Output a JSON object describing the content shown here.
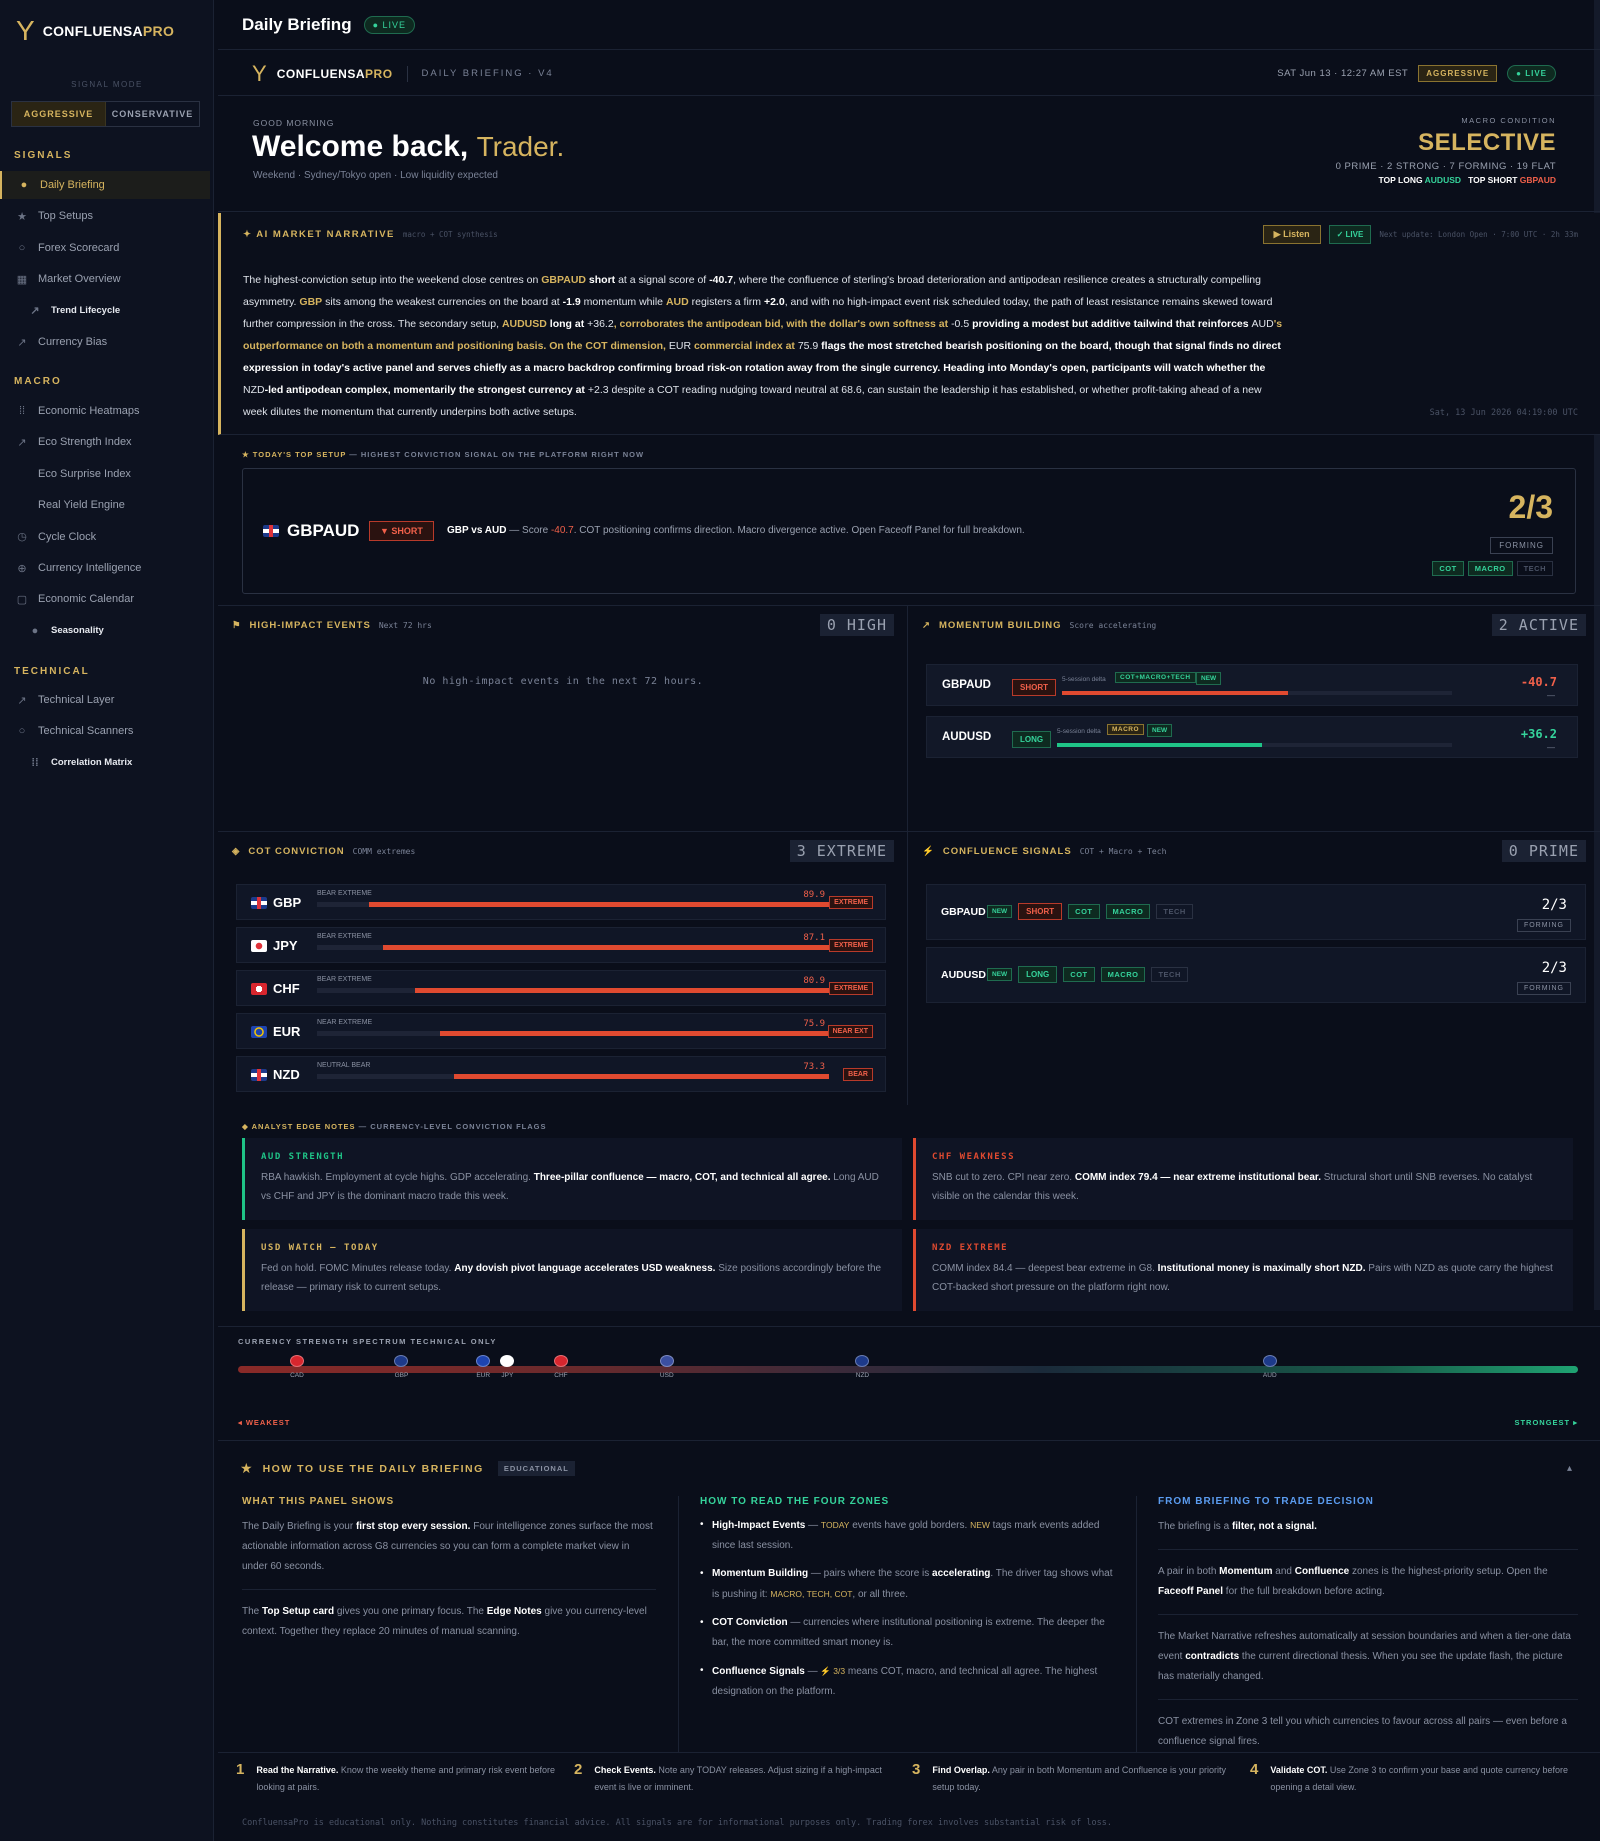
{
  "sidebar": {
    "brand": "CONFLUENSA",
    "brand_pro": "PRO",
    "signal_mode_label": "SIGNAL MODE",
    "mode_aggressive": "AGGRESSIVE",
    "mode_conservative": "CONSERVATIVE",
    "signals_title": "SIGNALS",
    "signals": [
      {
        "label": "Daily Briefing",
        "icon": "person-icon"
      },
      {
        "label": "Top Setups",
        "icon": "star-icon"
      },
      {
        "label": "Forex Scorecard",
        "icon": "circle-icon"
      },
      {
        "label": "Market Overview",
        "icon": "grid-icon"
      },
      {
        "label": "Trend Lifecycle",
        "icon": "trend-icon"
      },
      {
        "label": "Currency Bias",
        "icon": "trend-icon"
      }
    ],
    "macro_title": "MACRO",
    "macro": [
      {
        "label": "Economic Heatmaps",
        "icon": "dots-grid-icon"
      },
      {
        "label": "Eco Strength Index",
        "icon": "trend-icon"
      },
      {
        "label": "Eco Surprise Index",
        "icon": ""
      },
      {
        "label": "Real Yield Engine",
        "icon": ""
      },
      {
        "label": "Cycle Clock",
        "icon": "clock-icon"
      },
      {
        "label": "Currency Intelligence",
        "icon": "plus-circle-icon"
      },
      {
        "label": "Economic Calendar",
        "icon": "square-icon"
      },
      {
        "label": "Seasonality",
        "icon": "dot-icon"
      }
    ],
    "technical_title": "TECHNICAL",
    "technical": [
      {
        "label": "Technical Layer",
        "icon": "trend-icon"
      },
      {
        "label": "Technical Scanners",
        "icon": "circle-icon"
      },
      {
        "label": "Correlation Matrix",
        "icon": "dots-grid-icon"
      }
    ]
  },
  "topbar": {
    "title": "Daily Briefing",
    "live": "● LIVE"
  },
  "header": {
    "brand": "CONFLUENSA",
    "brand_pro": "PRO",
    "version": "DAILY BRIEFING · V4",
    "datetime": "SAT Jun 13 · 12:27 AM EST",
    "mode": "AGGRESSIVE",
    "live": "● LIVE"
  },
  "welcome": {
    "greeting": "GOOD MORNING",
    "title": "Welcome back,",
    "name": "Trader.",
    "subtitle": "Weekend · Sydney/Tokyo open · Low liquidity expected",
    "macro_label": "MACRO CONDITION",
    "macro_value": "SELECTIVE",
    "counts": "0 PRIME · 2 STRONG · 7 FORMING · 19 FLAT",
    "top_long_label": "TOP LONG",
    "top_long": "AUDUSD",
    "top_short_label": "TOP SHORT",
    "top_short": "GBPAUD"
  },
  "narrative": {
    "title": "✦ AI  MARKET NARRATIVE",
    "meta": "macro + COT synthesis",
    "listen": "▶ Listen",
    "live": "✓ LIVE",
    "next_update": "Next update: London Open · 7:00 UTC · 2h 33m",
    "text_parts": [
      "The highest-conviction setup into the weekend close centres on ",
      "GBPAUD",
      " short",
      " at a signal score of ",
      "-40.7",
      ", where the confluence of sterling's broad deterioration and antipodean resilience creates a structurally compelling asymmetry. ",
      "GBP",
      " sits among the weakest currencies on the board at ",
      "-1.9",
      " momentum while ",
      "AUD",
      " registers a firm ",
      "+2.0",
      ", and with no high-impact event risk scheduled today, the path of least resistance remains skewed toward further compression in the cross. The secondary setup, ",
      "AUDUSD",
      " long",
      " at ",
      "+36.2",
      ", corroborates the antipodean bid, with the dollar's own softness at ",
      "-0.5",
      " providing a modest but additive tailwind that reinforces ",
      "AUD",
      "'s outperformance on both a momentum and positioning basis. On the COT dimension, ",
      "EUR",
      " commercial index at ",
      "75.9",
      " flags the most stretched bearish positioning on the board, though that signal finds no direct expression in today's active panel and serves chiefly as a macro backdrop confirming broad risk-on rotation away from the single currency. Heading into Monday's open, participants will watch whether the ",
      "NZD",
      "-led antipodean complex, momentarily the strongest currency at ",
      "+2.3",
      " despite a COT reading nudging toward neutral at ",
      "68.6",
      ", can sustain the leadership it has established, or whether profit-taking ahead of a new week dilutes the momentum that currently underpins both active setups."
    ],
    "timestamp": "Sat, 13 Jun 2026 04:19:00 UTC"
  },
  "top_setup": {
    "header": "★ TODAY'S TOP SETUP",
    "header_sub": " — HIGHEST CONVICTION SIGNAL ON THE PLATFORM RIGHT NOW",
    "pair": "GBPAUD",
    "direction": "▼ SHORT",
    "desc_pair": "GBP vs AUD",
    "desc_mid": " — Score ",
    "desc_score": "-40.7",
    "desc_tail": ". COT positioning confirms direction. Macro divergence active. Open Faceoff Panel for full breakdown.",
    "score": "2/3",
    "status": "FORMING",
    "tags": [
      {
        "label": "COT",
        "on": true
      },
      {
        "label": "MACRO",
        "on": true
      },
      {
        "label": "TECH",
        "on": false
      }
    ]
  },
  "events": {
    "title": "HIGH-IMPACT EVENTS",
    "meta": "Next 72 hrs",
    "count": "0 HIGH",
    "empty": "No high-impact events in the next 72 hours."
  },
  "momentum": {
    "title": "MOMENTUM BUILDING",
    "meta": "Score accelerating",
    "count": "2 ACTIVE",
    "rows": [
      {
        "pair": "GBPAUD",
        "dir": "SHORT",
        "delta_label": "5-session delta",
        "driver": "COT+MACRO+TECH",
        "new": "NEW",
        "value": "-40.7",
        "sub": "—",
        "fill": 0.58,
        "color": "#e04a30"
      },
      {
        "pair": "AUDUSD",
        "dir": "LONG",
        "delta_label": "5-session delta",
        "driver": "MACRO",
        "new": "NEW",
        "value": "+36.2",
        "sub": "—",
        "fill": 0.52,
        "color": "#1fc487"
      }
    ]
  },
  "cot": {
    "title": "COT CONVICTION",
    "meta": "COMM extremes",
    "count": "3 EXTREME",
    "rows": [
      {
        "ccy": "GBP",
        "label": "BEAR EXTREME",
        "value": "89.9",
        "tag": "EXTREME",
        "fill": 0.899
      },
      {
        "ccy": "JPY",
        "label": "BEAR EXTREME",
        "value": "87.1",
        "tag": "EXTREME",
        "fill": 0.871
      },
      {
        "ccy": "CHF",
        "label": "BEAR EXTREME",
        "value": "80.9",
        "tag": "EXTREME",
        "fill": 0.809
      },
      {
        "ccy": "EUR",
        "label": "NEAR EXTREME",
        "value": "75.9",
        "tag": "NEAR EXT",
        "fill": 0.759
      },
      {
        "ccy": "NZD",
        "label": "NEUTRAL BEAR",
        "value": "73.3",
        "tag": "BEAR",
        "fill": 0.733
      }
    ]
  },
  "confluence": {
    "title": "CONFLUENCE SIGNALS",
    "meta": "COT + Macro + Tech",
    "count": "0 PRIME",
    "rows": [
      {
        "pair": "GBPAUD",
        "new": "NEW",
        "dir": "SHORT",
        "score": "2/3",
        "status": "FORMING"
      },
      {
        "pair": "AUDUSD",
        "new": "NEW",
        "dir": "LONG",
        "score": "2/3",
        "status": "FORMING"
      }
    ],
    "tags": [
      "COT",
      "MACRO",
      "TECH"
    ]
  },
  "edge": {
    "header": "◆ ANALYST EDGE NOTES",
    "header_sub": " — CURRENCY-LEVEL CONVICTION FLAGS",
    "notes": [
      {
        "title": "AUD STRENGTH",
        "pre": "RBA hawkish. Employment at cycle highs. GDP accelerating. ",
        "bold": "Three-pillar confluence — macro, COT, and technical all agree.",
        "post": " Long AUD vs CHF and JPY is the dominant macro trade this week.",
        "color": "#1fc487"
      },
      {
        "title": "CHF WEAKNESS",
        "pre": "SNB cut to zero. CPI near zero. ",
        "bold": "COMM index 79.4 — near extreme institutional bear.",
        "post": " Structural short until SNB reverses. No catalyst visible on the calendar this week.",
        "color": "#e04a30"
      },
      {
        "title": "USD WATCH — TODAY",
        "pre": "Fed on hold. FOMC Minutes release today. ",
        "bold": "Any dovish pivot language accelerates USD weakness.",
        "post": " Size positions accordingly before the release — primary risk to current setups.",
        "color": "#d6b45f"
      },
      {
        "title": "NZD EXTREME",
        "pre": "COMM index 84.4 — deepest bear extreme in G8. ",
        "bold": "Institutional money is maximally short NZD.",
        "post": " Pairs with NZD as quote carry the highest COT-backed short pressure on the platform right now.",
        "color": "#e04a30"
      }
    ]
  },
  "spectrum": {
    "header": "CURRENCY STRENGTH SPECTRUM   TECHNICAL ONLY",
    "currencies": [
      {
        "code": "CAD",
        "pos": 0.044,
        "color": "#d8262e"
      },
      {
        "code": "GBP",
        "pos": 0.122,
        "color": "#1d3a8a"
      },
      {
        "code": "EUR",
        "pos": 0.183,
        "color": "#1e44b0"
      },
      {
        "code": "JPY",
        "pos": 0.201,
        "color": "#ffffff"
      },
      {
        "code": "CHF",
        "pos": 0.241,
        "color": "#d8262e"
      },
      {
        "code": "USD",
        "pos": 0.32,
        "color": "#3b4fa0"
      },
      {
        "code": "NZD",
        "pos": 0.466,
        "color": "#1d3a8a"
      },
      {
        "code": "AUD",
        "pos": 0.77,
        "color": "#1d3a8a"
      }
    ],
    "weakest": "◂ WEAKEST",
    "strongest": "STRONGEST ▸"
  },
  "how": {
    "title": "HOW TO USE THE DAILY BRIEFING",
    "badge": "EDUCATIONAL",
    "collapse": "▴",
    "col1_title": "WHAT THIS PANEL SHOWS",
    "col1_p1_a": "The Daily Briefing is your ",
    "col1_p1_b": "first stop every session.",
    "col1_p1_c": " Four intelligence zones surface the most actionable information across G8 currencies so you can form a complete market view in under 60 seconds.",
    "col1_p2_a": "The ",
    "col1_p2_b": "Top Setup card",
    "col1_p2_c": " gives you one primary focus. The ",
    "col1_p2_d": "Edge Notes",
    "col1_p2_e": " give you currency-level context. Together they replace 20 minutes of manual scanning.",
    "col2_title": "HOW TO READ THE FOUR ZONES",
    "col2_items": [
      {
        "b": "High-Impact Events",
        "t1": " — ",
        "g": "TODAY",
        "t2": " events have gold borders. ",
        "g2": "NEW",
        "t3": " tags mark events added since last session."
      },
      {
        "b": "Momentum Building",
        "t1": " — pairs where the score is ",
        "g": "",
        "t2": "",
        "g2": "",
        "t3": "",
        "b2": "accelerating",
        "t4": ". The driver tag shows what is pushing it: ",
        "g3": "MACRO, TECH, COT",
        "t5": ", or all three."
      },
      {
        "b": "COT Conviction",
        "t1": " — currencies where institutional positioning is extreme. The deeper the bar, the more committed smart money is."
      },
      {
        "b": "Confluence Signals",
        "t1": " — ",
        "g": "⚡ 3/3",
        "t2": " means COT, macro, and technical all agree. The highest designation on the platform."
      }
    ],
    "col3_title": "FROM BRIEFING TO TRADE DECISION",
    "col3_p1_a": "The briefing is a ",
    "col3_p1_b": "filter, not a signal.",
    "col3_p2_a": "A pair in both ",
    "col3_p2_b": "Momentum",
    "col3_p2_c": " and ",
    "col3_p2_d": "Confluence",
    "col3_p2_e": " zones is the highest-priority setup. Open the ",
    "col3_p2_f": "Faceoff Panel",
    "col3_p2_g": " for the full breakdown before acting.",
    "col3_p3_a": "The Market Narrative refreshes automatically at session boundaries and when a tier-one data event ",
    "col3_p3_b": "contradicts",
    "col3_p3_c": " the current directional thesis. When you see the update flash, the picture has materially changed.",
    "col3_p4": "COT extremes in Zone 3 tell you which currencies to favour across all pairs — even before a confluence signal fires."
  },
  "steps": [
    {
      "n": "1",
      "b": "Read the Narrative.",
      "t": " Know the weekly theme and primary risk event before looking at pairs."
    },
    {
      "n": "2",
      "b": "Check Events.",
      "t": " Note any TODAY releases. Adjust sizing if a high-impact event is live or imminent."
    },
    {
      "n": "3",
      "b": "Find Overlap.",
      "t": " Any pair in both Momentum and Confluence is your priority setup today."
    },
    {
      "n": "4",
      "b": "Validate COT.",
      "t": " Use Zone 3 to confirm your base and quote currency before opening a detail view."
    }
  ],
  "footer": "ConfluensaPro is educational only. Nothing constitutes financial advice. All signals are for informational purposes only. Trading forex involves substantial risk of loss."
}
